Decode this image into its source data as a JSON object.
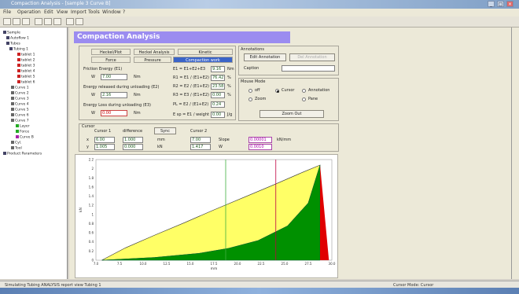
{
  "window": {
    "title": "Compaction Analysis - [sample 3 Curve B]"
  },
  "menu": [
    "File",
    "Operation",
    "Edit",
    "View",
    "Import",
    "Tools",
    "Window",
    "?"
  ],
  "tree": {
    "items": [
      "Sample",
      "Autoflow 1",
      "Tubes",
      "Tubing 1",
      "tablet 1",
      "tablet 2",
      "tablet 3",
      "tablet 4",
      "tablet 5",
      "tablet 6",
      "Curve 1",
      "Curve 2",
      "Curve 3",
      "Curve 4",
      "Curve 5",
      "Curve 6",
      "Curve 7",
      "Layer",
      "Force",
      "Curve B",
      "Cyl.",
      "Tool",
      "Product Parameters"
    ]
  },
  "banner": {
    "title": "Compaction Analysis"
  },
  "tabs": [
    "Heckel/Plot",
    "Heckel Analysis",
    "Kinetic",
    "Force",
    "Pressure",
    "Compaction work"
  ],
  "left_params": {
    "friction_label": "Friction Energy (E1)",
    "friction_value": "7.00",
    "friction_unit": "Nm",
    "elastic_label": "Energy released during unloading (E2)",
    "elastic_value": "2.16",
    "elastic_unit": "Nm",
    "loss_label": "Energy Loss during unloading (E3)",
    "loss_value": "0.00",
    "loss_unit": "Nm",
    "prefix": "W"
  },
  "right_params": [
    {
      "label": "E1 = E1+E2+E3",
      "value": "9.16",
      "unit": "Nm"
    },
    {
      "label": "R1 = E1 / (E1+E2) * 100",
      "value": "76.42",
      "unit": "%"
    },
    {
      "label": "R2 = E2 / (E1+E2) * 100",
      "value": "23.58",
      "unit": "%"
    },
    {
      "label": "R3 = E3 / (E1+E2) * 100",
      "value": "0.00",
      "unit": "%"
    },
    {
      "label": "PL = E2 / (E1+E2)",
      "value": "0.24",
      "unit": ""
    },
    {
      "label": "E sp = E1 / weight",
      "value": "0.00",
      "unit": "J/g"
    }
  ],
  "annotations": {
    "header": "Annotations",
    "edit_btn": "Edit Annotation",
    "delete_btn": "Del Annotation",
    "caption_label": "Caption"
  },
  "mouse_mode": {
    "header": "Mouse Mode",
    "options": [
      "off",
      "Cursor",
      "Annotation",
      "Zoom",
      "Pane"
    ],
    "selected": "Cursor",
    "zoom_out": "Zoom Out"
  },
  "cursor": {
    "header": "Cursor",
    "col1": "Cursor 1",
    "col2": "difference",
    "col3": "Cursor 2",
    "sync_btn": "Sync",
    "x_label": "x",
    "y_label": "y",
    "c1_x": "6.00",
    "c1_y": "1.005",
    "diff_x": "1.000",
    "diff_y": "0.000",
    "unit_x": "mm",
    "unit_y": "kN",
    "c2_x": "7.00",
    "c2_y": "1.417",
    "slope_label": "Slope",
    "slope_value": "0.00001",
    "slope_unit": "kN/mm",
    "area_label": "W",
    "area_value": "0.0010"
  },
  "chart_data": {
    "type": "area",
    "xlabel": "mm",
    "ylabel": "kN",
    "xlim": [
      0,
      8
    ],
    "ylim": [
      0,
      2.2
    ],
    "x_ticks": [
      "7.0",
      "7.5",
      "10.0",
      "12.5",
      "15.0",
      "17.5",
      "20.0",
      "22.5",
      "25.0",
      "27.5",
      "30.0"
    ],
    "y_ticks": [
      "0",
      "0.2",
      "0.4",
      "0.6",
      "0.8",
      "1",
      "1.2",
      "1.4",
      "1.6",
      "1.8",
      "2",
      "2.2"
    ],
    "loading_curve": {
      "x": [
        0.2,
        1,
        2,
        3,
        4,
        5,
        6,
        7,
        7.6
      ],
      "y": [
        0,
        0.27,
        0.55,
        0.82,
        1.1,
        1.37,
        1.64,
        1.92,
        2.08
      ]
    },
    "unloading_curve": {
      "x": [
        0.2,
        2,
        3.5,
        4.5,
        5.5,
        6.5,
        7.2,
        7.6
      ],
      "y": [
        0,
        0.06,
        0.15,
        0.26,
        0.43,
        0.75,
        1.25,
        2.08
      ]
    },
    "cursor1_x": 4.4,
    "cursor2_x": 6.1,
    "colors": {
      "friction": "#ffff66",
      "work": "#009000",
      "elastic": "#e00000",
      "cursor1": "#40b040",
      "cursor2": "#c00040"
    }
  },
  "status": {
    "left": "Simulating Tubing ANALYSIS report view Tubing 1",
    "right": "Cursor Mode: Cursor"
  }
}
